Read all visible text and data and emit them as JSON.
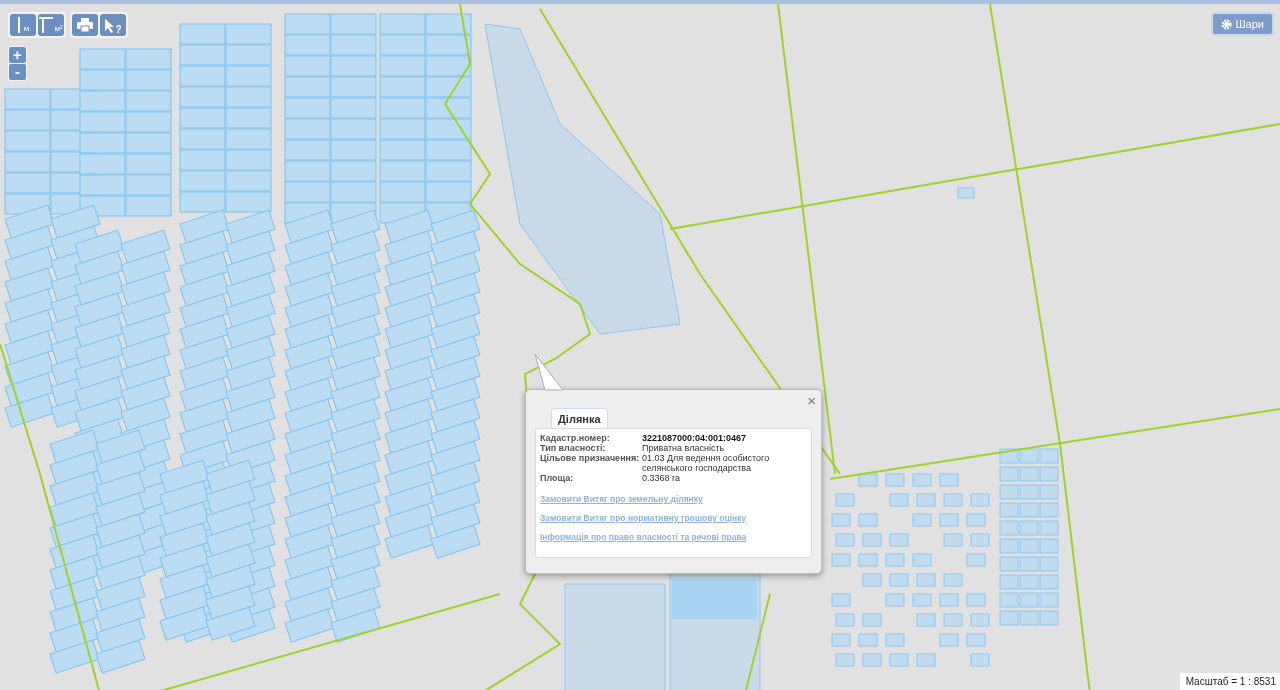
{
  "toolbar": [
    {
      "kind": "distance",
      "label": "м"
    },
    {
      "kind": "area",
      "label": "м²"
    },
    {
      "kind": "print"
    },
    {
      "kind": "identify",
      "label": "?"
    }
  ],
  "zoom": {
    "in": "+",
    "out": "-"
  },
  "layers_button": {
    "label": "Шари"
  },
  "popup": {
    "tabs": [
      {
        "label": "Ділянка",
        "selected": true
      }
    ],
    "close": "×",
    "fields": [
      {
        "label": "Кадастр.номер:",
        "value": "3221087000:04:001:0467",
        "emphasis": true
      },
      {
        "label": "Тип власності:",
        "value": "Приватна власність",
        "emphasis": false
      },
      {
        "label": "Цільове призначення:",
        "value": "01.03 Для ведення особистого селянського господарства",
        "emphasis": false
      },
      {
        "label": "Площа:",
        "value": "0.3368 га",
        "emphasis": false
      }
    ],
    "links": [
      "Замовити Витяг про земельну ділянку",
      "Замовити Витяг про нормативну грошову оцінку",
      "Інформація про право власності та речові права"
    ]
  },
  "scale": "Масштаб = 1 : 8531"
}
